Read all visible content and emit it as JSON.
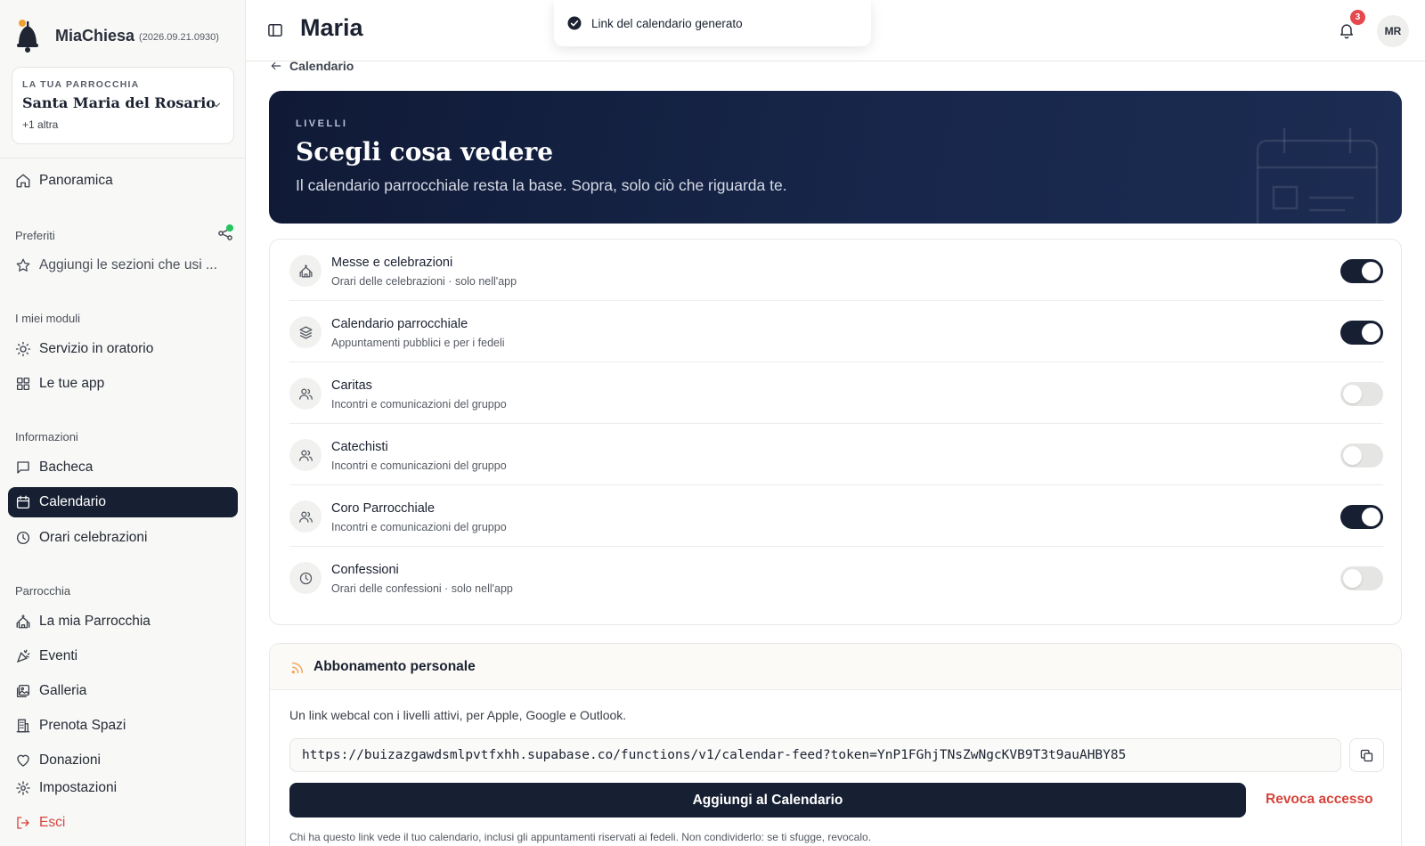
{
  "app": {
    "name": "MiaChiesa",
    "version": "(2026.09.21.0930)"
  },
  "parish_switcher": {
    "label": "LA TUA PARROCCHIA",
    "name": "Santa Maria del Rosario",
    "more": "+1 altra"
  },
  "sidebar": {
    "overview": "Panoramica",
    "favorites_label": "Preferiti",
    "favorites_empty": "Aggiungi le sezioni che usi ...",
    "modules_label": "I miei moduli",
    "modules": [
      {
        "label": "Servizio in oratorio",
        "icon": "sun-icon"
      },
      {
        "label": "Le tue app",
        "icon": "grid-icon"
      }
    ],
    "info_label": "Informazioni",
    "info": [
      {
        "label": "Bacheca",
        "icon": "message-icon"
      },
      {
        "label": "Calendario",
        "icon": "calendar-icon",
        "active": true
      },
      {
        "label": "Orari celebrazioni",
        "icon": "clock-icon"
      }
    ],
    "parish_label": "Parrocchia",
    "parish": [
      {
        "label": "La mia Parrocchia",
        "icon": "church-icon"
      },
      {
        "label": "Eventi",
        "icon": "party-icon"
      },
      {
        "label": "Galleria",
        "icon": "gallery-icon"
      },
      {
        "label": "Prenota Spazi",
        "icon": "building-icon"
      },
      {
        "label": "Donazioni",
        "icon": "heart-icon"
      }
    ],
    "settings": "Impostazioni",
    "logout": "Esci"
  },
  "header": {
    "title": "Maria",
    "notifications_count": "3",
    "avatar_initials": "MR"
  },
  "toast": {
    "message": "Link del calendario generato"
  },
  "breadcrumb": {
    "back_label": "Calendario"
  },
  "hero": {
    "kicker": "LIVELLI",
    "title": "Scegli cosa vedere",
    "subtitle": "Il calendario parrocchiale resta la base. Sopra, solo ciò che riguarda te."
  },
  "layers": [
    {
      "title": "Messe e celebrazioni",
      "subtitle": "Orari delle celebrazioni · solo nell'app",
      "icon": "church-icon",
      "enabled": true
    },
    {
      "title": "Calendario parrocchiale",
      "subtitle": "Appuntamenti pubblici e per i fedeli",
      "icon": "layers-icon",
      "enabled": true
    },
    {
      "title": "Caritas",
      "subtitle": "Incontri e comunicazioni del gruppo",
      "icon": "users-icon",
      "enabled": false
    },
    {
      "title": "Catechisti",
      "subtitle": "Incontri e comunicazioni del gruppo",
      "icon": "users-icon",
      "enabled": false
    },
    {
      "title": "Coro Parrocchiale",
      "subtitle": "Incontri e comunicazioni del gruppo",
      "icon": "users-icon",
      "enabled": true
    },
    {
      "title": "Confessioni",
      "subtitle": "Orari delle confessioni · solo nell'app",
      "icon": "clock-icon",
      "enabled": false
    }
  ],
  "subscription": {
    "title": "Abbonamento personale",
    "description": "Un link webcal con i livelli attivi, per Apple, Google e Outlook.",
    "url": "https://buizazgawdsmlpvtfxhh.supabase.co/functions/v1/calendar-feed?token=YnP1FGhjTNsZwNgcKVB9T3t9auAHBY85",
    "add_button": "Aggiungi al Calendario",
    "revoke_button": "Revoca accesso",
    "warning": "Chi ha questo link vede il tuo calendario, inclusi gli appuntamenti riservati ai fedeli. Non condividerlo: se ti sfugge, revocalo."
  },
  "colors": {
    "primary": "#172033",
    "danger": "#d6443a",
    "badge": "#e5484d",
    "online": "#22c55e",
    "rss": "#f0a45c"
  }
}
